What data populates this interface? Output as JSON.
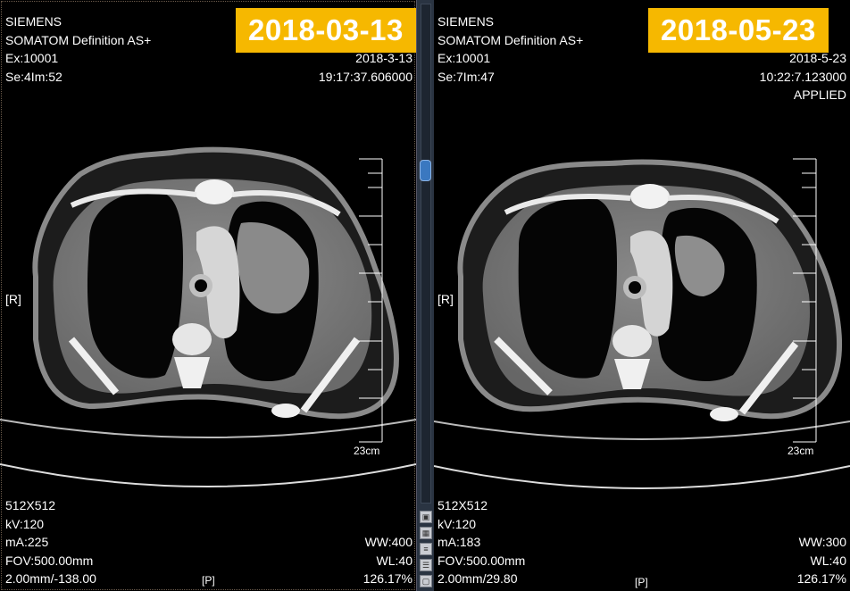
{
  "left": {
    "date_badge": "2018-03-13",
    "manufacturer": "SIEMENS",
    "model": "SOMATOM Definition AS+",
    "exam": "Ex:10001",
    "series_image": "Se:4Im:52",
    "date": "2018-3-13",
    "time": "19:17:37.606000",
    "orientation_left": "[R]",
    "orientation_bottom": "[P]",
    "scale_label": "23cm",
    "matrix": "512X512",
    "kv": "kV:120",
    "ma": "mA:225",
    "fov": "FOV:500.00mm",
    "slice": "2.00mm/-138.00",
    "ww": "WW:400",
    "wl": "WL:40",
    "zoom": "126.17%"
  },
  "right": {
    "date_badge": "2018-05-23",
    "manufacturer": "SIEMENS",
    "model": "SOMATOM Definition AS+",
    "exam": "Ex:10001",
    "series_image": "Se:7Im:47",
    "date": "2018-5-23",
    "time": "10:22:7.123000",
    "applied": "APPLIED",
    "orientation_left": "[R]",
    "orientation_bottom": "[P]",
    "scale_label": "23cm",
    "matrix": "512X512",
    "kv": "kV:120",
    "ma": "mA:183",
    "fov": "FOV:500.00mm",
    "slice": "2.00mm/29.80",
    "ww": "WW:300",
    "wl": "WL:40",
    "zoom": "126.17%"
  },
  "icons": {
    "scrollbar": "vertical-scrollbar",
    "tools": [
      "layout-icon",
      "grid-icon",
      "list-icon",
      "menu-icon",
      "window-icon"
    ]
  },
  "colors": {
    "badge": "#f6b800",
    "divider": "#2a3442",
    "scroll_thumb": "#3a78c0"
  }
}
